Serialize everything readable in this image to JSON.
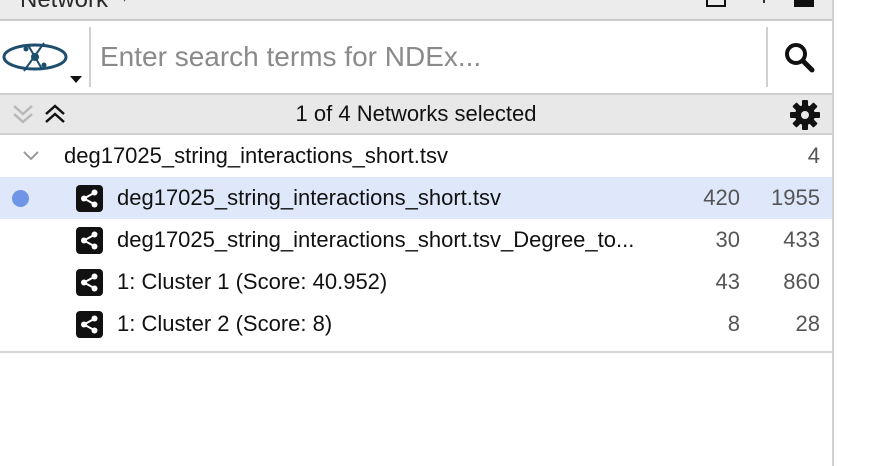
{
  "title_bar": {
    "title": "Network"
  },
  "search": {
    "placeholder": "Enter search terms for NDEx..."
  },
  "header": {
    "selected_label": "1 of 4 Networks selected"
  },
  "collection": {
    "name": "deg17025_string_interactions_short.tsv",
    "count": "4"
  },
  "networks": [
    {
      "name": "deg17025_string_interactions_short.tsv",
      "nodes": "420",
      "edges": "1955",
      "selected": true
    },
    {
      "name": "deg17025_string_interactions_short.tsv_Degree_to...",
      "nodes": "30",
      "edges": "433",
      "selected": false
    },
    {
      "name": "1: Cluster 1 (Score: 40.952)",
      "nodes": "43",
      "edges": "860",
      "selected": false
    },
    {
      "name": "1: Cluster 2 (Score: 8)",
      "nodes": "8",
      "edges": "28",
      "selected": false
    }
  ],
  "icons": {
    "logo": "ndex-logo-icon",
    "search": "search-icon",
    "collapse": "double-chevron-down-icon",
    "expand": "double-chevron-up-icon",
    "settings": "gear-icon",
    "network": "share-icon",
    "tree_toggle": "chevron-down-icon"
  },
  "colors": {
    "selection": "#dfe8fb",
    "current_dot": "#6f95e6",
    "header_bg": "#e8e8e8"
  }
}
